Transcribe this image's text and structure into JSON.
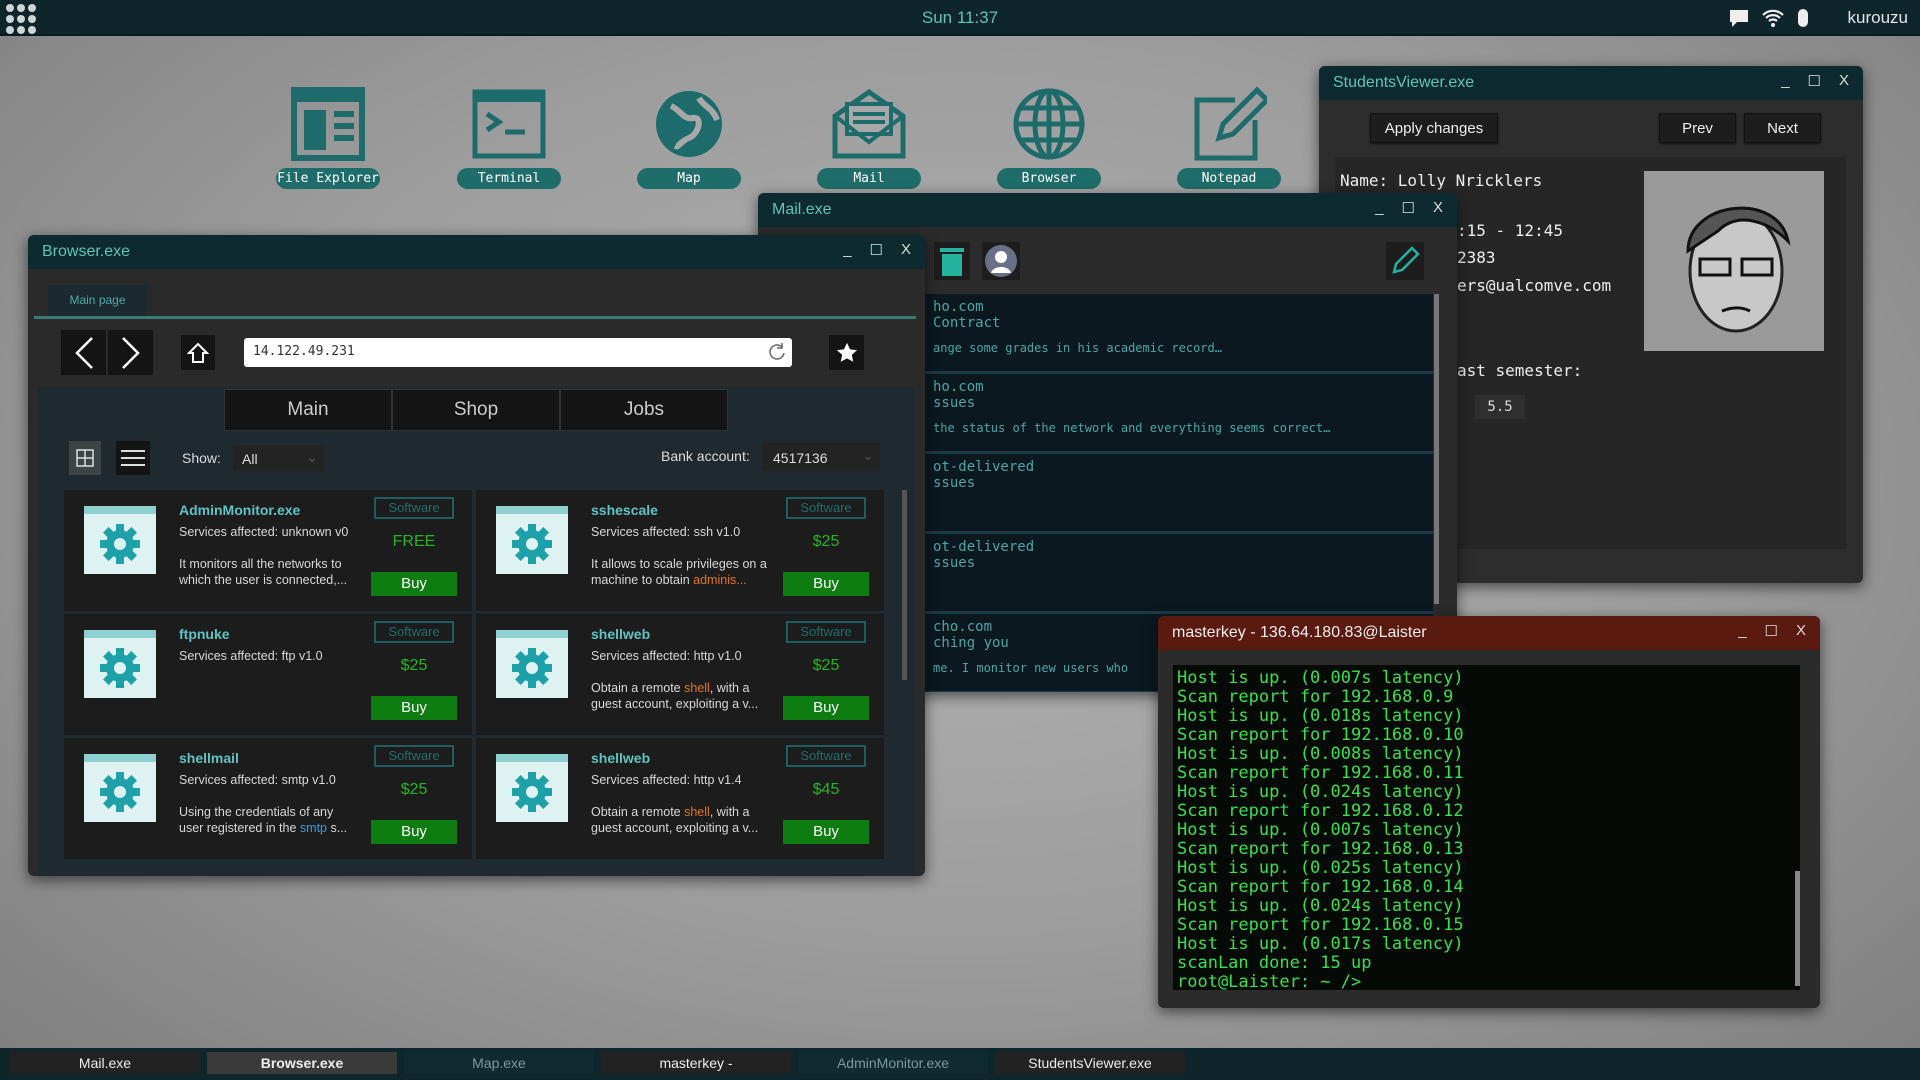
{
  "topbar": {
    "clock": "Sun 11:37",
    "username": "kurouzu",
    "icons": [
      "apps-grid-icon",
      "chat-icon",
      "wifi-icon",
      "user-icon"
    ]
  },
  "desktop": {
    "icons": [
      {
        "label": "File Explorer",
        "icon": "file-explorer-icon"
      },
      {
        "label": "Terminal",
        "icon": "terminal-icon"
      },
      {
        "label": "Map",
        "icon": "globe-map-icon"
      },
      {
        "label": "Mail",
        "icon": "mail-icon"
      },
      {
        "label": "Browser",
        "icon": "browser-globe-icon"
      },
      {
        "label": "Notepad",
        "icon": "notepad-icon"
      }
    ]
  },
  "browser": {
    "title": "Browser.exe",
    "tab": "Main page",
    "url": "14.122.49.231",
    "nav_tabs": [
      "Main",
      "Shop",
      "Jobs"
    ],
    "show_label": "Show:",
    "show_value": "All",
    "bank_label": "Bank account:",
    "bank_value": "4517136",
    "products": [
      {
        "name": "AdminMonitor.exe",
        "services": "Services affected: unknown v0",
        "desc": [
          "It monitors all the networks to which the user is connected,..."
        ],
        "badge": "Software",
        "price": "FREE",
        "buy": "Buy"
      },
      {
        "name": "sshescale",
        "services": "Services affected: ssh v1.0",
        "desc": [
          "It allows to scale privileges on a machine to obtain ",
          "adminis...",
          ""
        ],
        "badge": "Software",
        "price": "$25",
        "buy": "Buy"
      },
      {
        "name": "ftpnuke",
        "services": "Services affected: ftp v1.0",
        "desc": [
          ""
        ],
        "badge": "Software",
        "price": "$25",
        "buy": "Buy"
      },
      {
        "name": "shellweb",
        "services": "Services affected: http v1.0",
        "desc": [
          "Obtain a remote ",
          "shell",
          ", with a guest account, exploiting a v..."
        ],
        "badge": "Software",
        "price": "$25",
        "buy": "Buy"
      },
      {
        "name": "shellmail",
        "services": "Services affected: smtp v1.0",
        "desc": [
          "Using the credentials of any user registered in the ",
          "smtp",
          " s..."
        ],
        "badge": "Software",
        "price": "$25",
        "buy": "Buy"
      },
      {
        "name": "shellweb",
        "services": "Services affected: http v1.4",
        "desc": [
          "Obtain a remote ",
          "shell",
          ", with a guest account, exploiting a v..."
        ],
        "badge": "Software",
        "price": "$45",
        "buy": "Buy"
      }
    ]
  },
  "mail": {
    "title": "Mail.exe",
    "items": [
      {
        "from": "ho.com",
        "subject": "Contract",
        "body": "ange some grades in his academic record…"
      },
      {
        "from": "ho.com",
        "subject": "ssues",
        "body": "the status of the network and everything seems correct…"
      },
      {
        "from": "ot-delivered",
        "subject": "ssues",
        "body": ""
      },
      {
        "from": "ot-delivered",
        "subject": "ssues",
        "body": ""
      },
      {
        "from": "cho.com",
        "subject": "ching you",
        "body": "me. I monitor new users who"
      }
    ]
  },
  "students": {
    "title": "StudentsViewer.exe",
    "apply": "Apply changes",
    "prev": "Prev",
    "next": "Next",
    "name": "Name: Lolly Nricklers",
    "time": ":15 - 12:45",
    "id": "2383",
    "email": "ers@ualcomve.com",
    "semester": "ast semester:",
    "grade": "5.5"
  },
  "terminal": {
    "title": "masterkey - 136.64.180.83@Laister",
    "lines": [
      "Host is up. (0.007s latency)",
      "Scan report for 192.168.0.9",
      "Host is up. (0.018s latency)",
      "Scan report for 192.168.0.10",
      "Host is up. (0.008s latency)",
      "Scan report for 192.168.0.11",
      "Host is up. (0.024s latency)",
      "Scan report for 192.168.0.12",
      "Host is up. (0.007s latency)",
      "Scan report for 192.168.0.13",
      "Host is up. (0.025s latency)",
      "Scan report for 192.168.0.14",
      "Host is up. (0.024s latency)",
      "Scan report for 192.168.0.15",
      "Host is up. (0.017s latency)",
      "scanLan done: 15 up",
      "root@Laister: ~ />"
    ]
  },
  "taskbar": {
    "items": [
      {
        "label": "Mail.exe",
        "state": "open"
      },
      {
        "label": "Browser.exe",
        "state": "active"
      },
      {
        "label": "Map.exe",
        "state": "minimized"
      },
      {
        "label": "masterkey -",
        "state": "open"
      },
      {
        "label": "AdminMonitor.exe",
        "state": "minimized"
      },
      {
        "label": "StudentsViewer.exe",
        "state": "open"
      }
    ]
  },
  "window_controls": {
    "min": "_",
    "max": "☐",
    "close": "X"
  },
  "colors": {
    "accent": "#5fc4b8",
    "buy": "#0d7d12",
    "terminal_text": "#3ae04a",
    "terminal_title": "#5a1a10"
  }
}
